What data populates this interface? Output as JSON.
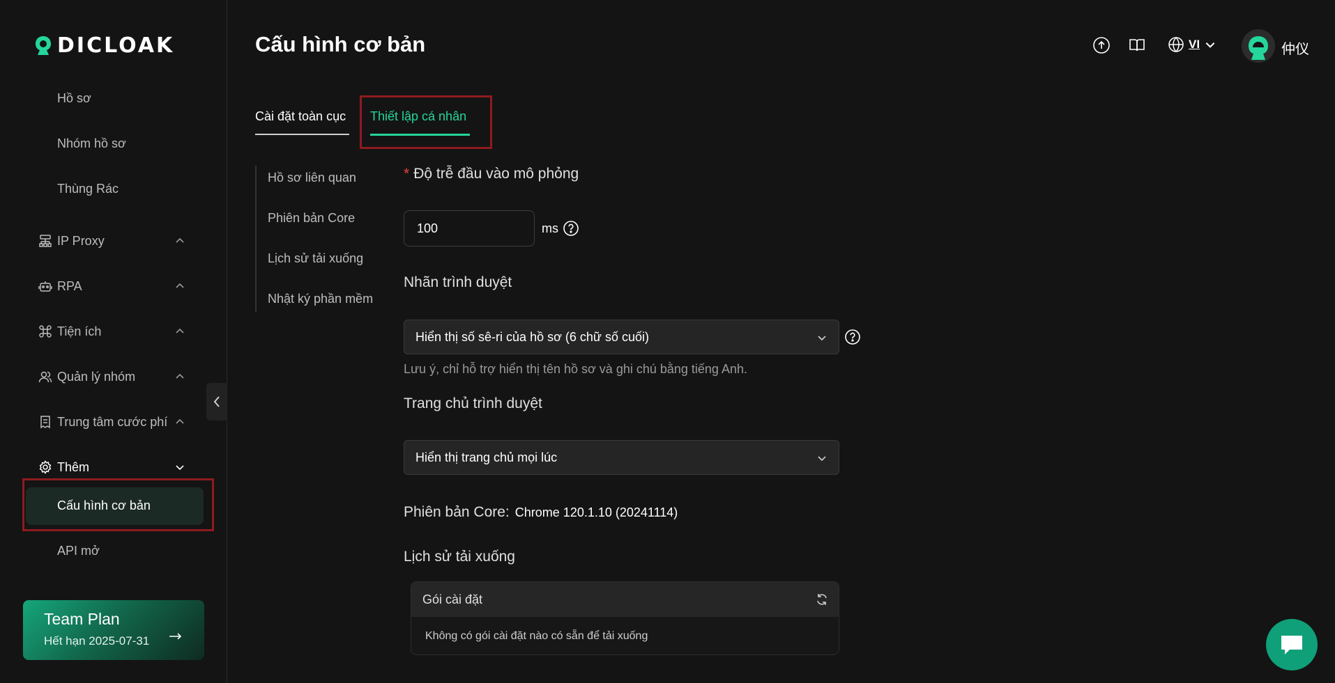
{
  "brand": {
    "name": "DICLOAK"
  },
  "sidebar": {
    "sub_items": [
      "Hồ sơ",
      "Nhóm hồ sơ",
      "Thùng Rác"
    ],
    "groups": [
      {
        "label": "IP Proxy",
        "icon": "network-icon"
      },
      {
        "label": "RPA",
        "icon": "robot-icon"
      },
      {
        "label": "Tiện ích",
        "icon": "command-icon"
      },
      {
        "label": "Quản lý nhóm",
        "icon": "users-icon"
      },
      {
        "label": "Trung tâm cước phí",
        "icon": "billing-icon"
      },
      {
        "label": "Thêm",
        "icon": "gear-icon"
      }
    ],
    "more_items": [
      "Cấu hình cơ bản",
      "API mở"
    ],
    "plan": {
      "title": "Team Plan",
      "expiry": "Hết hạn 2025-07-31"
    }
  },
  "header": {
    "title": "Cấu hình cơ bản",
    "lang_code": "VI",
    "username": "仲仪"
  },
  "tabs": [
    "Cài đặt toàn cục",
    "Thiết lập cá nhân"
  ],
  "subnav": [
    "Hồ sơ liên quan",
    "Phiên bản Core",
    "Lịch sử tải xuống",
    "Nhật ký phần mềm"
  ],
  "form": {
    "delay_label": "Độ trễ đầu vào mô phỏng",
    "delay_required": "*",
    "delay_value": "100",
    "delay_unit": "ms",
    "browser_label_title": "Nhãn trình duyệt",
    "browser_label_value": "Hiển thị số sê-ri của hồ sơ (6 chữ số cuối)",
    "browser_label_note": "Lưu ý, chỉ hỗ trợ hiển thị tên hồ sơ và ghi chú bằng tiếng Anh.",
    "homepage_title": "Trang chủ trình duyệt",
    "homepage_value": "Hiển thị trang chủ mọi lúc",
    "core_label": "Phiên bản Core:",
    "core_value": "Chrome 120.1.10 (20241114)",
    "download_title": "Lịch sử tải xuống",
    "download_table": {
      "header": "Gói cài đặt",
      "empty": "Không có gói cài đặt nào có sẵn để tải xuống"
    }
  },
  "colors": {
    "accent": "#25d69c",
    "highlight_box": "#8e1b1f",
    "background": "#141414"
  }
}
